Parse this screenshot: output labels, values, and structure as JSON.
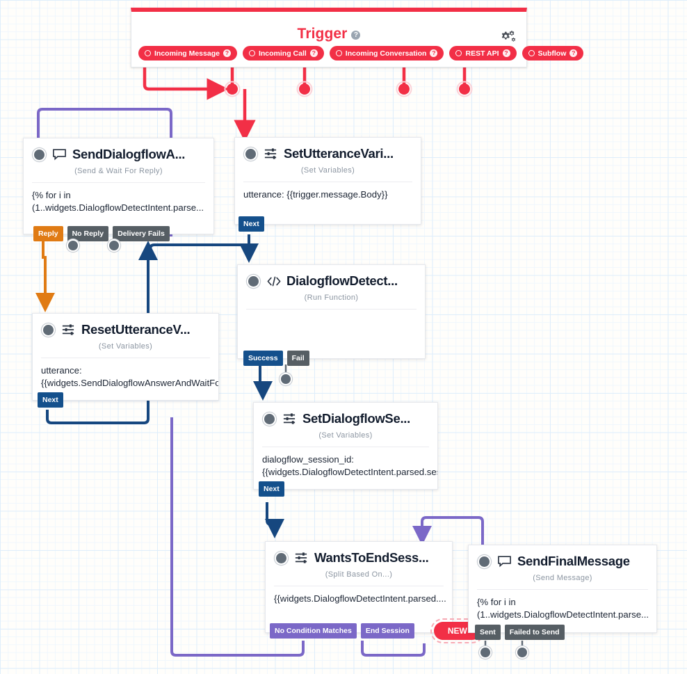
{
  "canvas": {
    "grid": true,
    "bg": "#fffefb",
    "grid_color": "#dfeefb"
  },
  "trigger": {
    "title": "Trigger",
    "help": "?",
    "accent": "#f22f46",
    "settings_icon": "cogs-icon",
    "ports": [
      {
        "label": "Incoming Message",
        "help": "?"
      },
      {
        "label": "Incoming Call",
        "help": "?"
      },
      {
        "label": "Incoming Conversation",
        "help": "?"
      },
      {
        "label": "REST API",
        "help": "?"
      },
      {
        "label": "Subflow",
        "help": "?"
      }
    ]
  },
  "nodes": [
    {
      "id": "send-dialogflow-answer",
      "title": "SendDialogflowA...",
      "subtitle": "(Send & Wait For Reply)",
      "icon": "chat-bubble-icon",
      "body": "{% for i in\n(1..widgets.DialogflowDetectIntent.parse...",
      "ports": [
        {
          "label": "Reply",
          "style": "orange"
        },
        {
          "label": "No Reply",
          "style": "grey"
        },
        {
          "label": "Delivery Fails",
          "style": "grey"
        }
      ]
    },
    {
      "id": "set-utterance-variables",
      "title": "SetUtteranceVari...",
      "subtitle": "(Set Variables)",
      "icon": "set-variables-icon",
      "body": "utterance: {{trigger.message.Body}}",
      "ports": [
        {
          "label": "Next",
          "style": "blue"
        }
      ]
    },
    {
      "id": "reset-utterance-variables",
      "title": "ResetUtteranceV...",
      "subtitle": "(Set Variables)",
      "icon": "set-variables-icon",
      "body": "utterance:\n{{widgets.SendDialogflowAnswerAndWaitForReply",
      "ports": [
        {
          "label": "Next",
          "style": "blue"
        }
      ]
    },
    {
      "id": "dialogflow-detect-intent",
      "title": "DialogflowDetect...",
      "subtitle": "(Run Function)",
      "icon": "code-icon",
      "body": "",
      "ports": [
        {
          "label": "Success",
          "style": "blue"
        },
        {
          "label": "Fail",
          "style": "grey"
        }
      ]
    },
    {
      "id": "set-dialogflow-session",
      "title": "SetDialogflowSe...",
      "subtitle": "(Set Variables)",
      "icon": "set-variables-icon",
      "body": "dialogflow_session_id:\n{{widgets.DialogflowDetectIntent.parsed.ses",
      "ports": [
        {
          "label": "Next",
          "style": "blue"
        }
      ]
    },
    {
      "id": "wants-to-end-session",
      "title": "WantsToEndSess...",
      "subtitle": "(Split Based On...)",
      "icon": "set-variables-icon",
      "body": "{{widgets.DialogflowDetectIntent.parsed....",
      "ports": [
        {
          "label": "No Condition Matches",
          "style": "purple"
        },
        {
          "label": "End Session",
          "style": "purple"
        },
        {
          "label": "NEW",
          "style": "new"
        }
      ]
    },
    {
      "id": "send-final-message",
      "title": "SendFinalMessage",
      "subtitle": "(Send Message)",
      "icon": "chat-bubble-icon",
      "body": "{% for i in\n(1..widgets.DialogflowDetectIntent.parse...",
      "ports": [
        {
          "label": "Sent",
          "style": "grey"
        },
        {
          "label": "Failed to Send",
          "style": "grey"
        }
      ]
    }
  ],
  "colors": {
    "trigger_red": "#f22f46",
    "blue_wire": "#16477f",
    "orange_wire": "#e07b14",
    "purple_wire": "#7b68c7",
    "grey_port": "#565e64"
  }
}
